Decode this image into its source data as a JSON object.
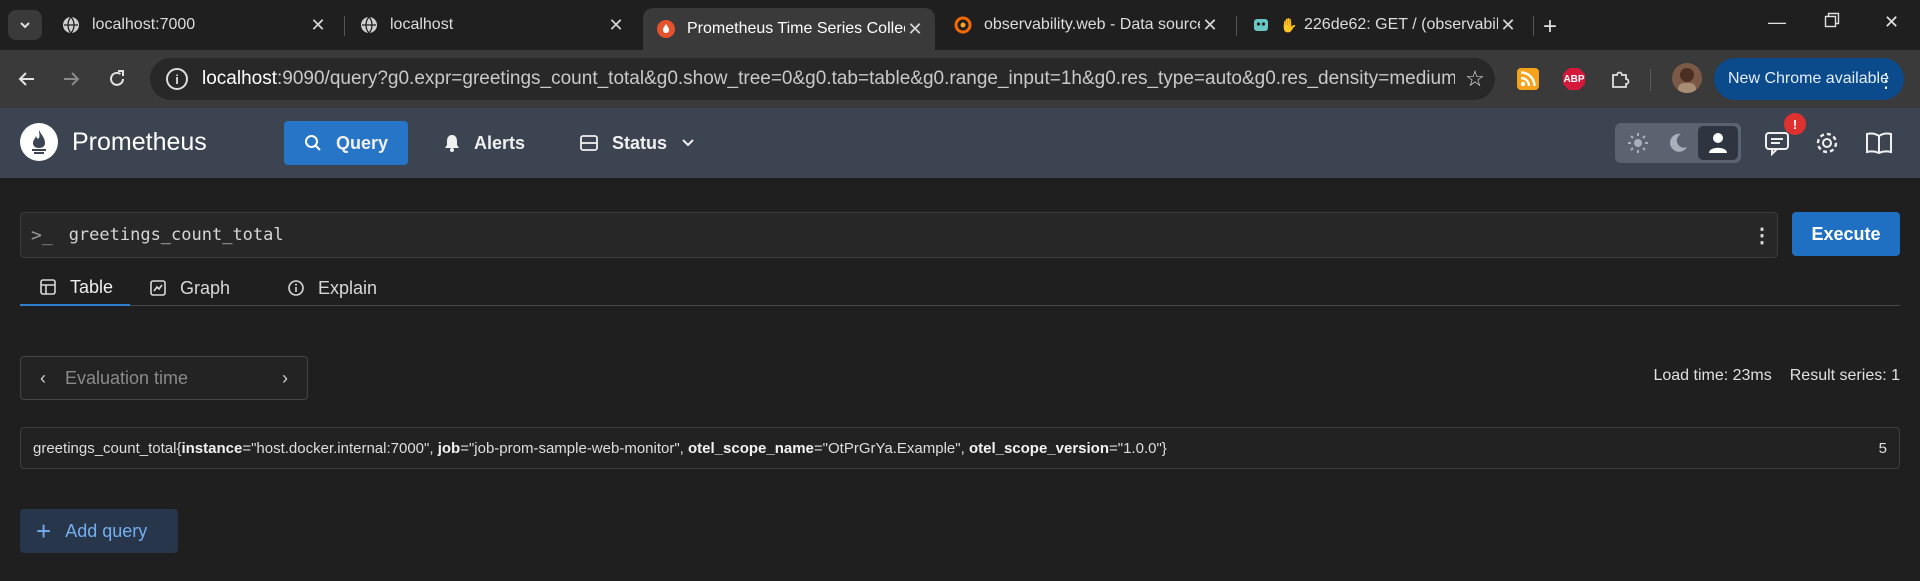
{
  "browser": {
    "tabs": [
      {
        "title": "localhost:7000",
        "favicon": "globe-icon"
      },
      {
        "title": "localhost",
        "favicon": "globe-icon"
      },
      {
        "title": "Prometheus Time Series Collect",
        "favicon": "prometheus-icon",
        "active": true
      },
      {
        "title": "observability.web - Data source",
        "favicon": "grafana-icon"
      },
      {
        "title": "226de62: GET / (observabilit",
        "favicon": "jaeger-icon"
      }
    ],
    "url_host": "localhost",
    "url_rest": ":9090/query?g0.expr=greetings_count_total&g0.show_tree=0&g0.tab=table&g0.range_input=1h&g0.res_type=auto&g0.res_density=medium&g0.dis...",
    "update_label": "New Chrome available",
    "abp_label": "ABP",
    "colors": {
      "tab_bg": "#1f1f1f",
      "toolbar_bg": "#3a3a3a",
      "update_bg": "#0b4a8b"
    }
  },
  "app": {
    "brand": "Prometheus",
    "nav": [
      {
        "label": "Query",
        "icon": "search-icon",
        "active": true
      },
      {
        "label": "Alerts",
        "icon": "bell-icon"
      },
      {
        "label": "Status",
        "icon": "server-icon",
        "dropdown": true
      }
    ],
    "notification_badge": "!",
    "colors": {
      "navbar_bg": "#3c4451",
      "accent": "#2775c6",
      "badge": "#e03131"
    }
  },
  "query": {
    "prompt": ">_",
    "expression": "greetings_count_total",
    "execute_label": "Execute",
    "tabs": [
      {
        "label": "Table",
        "icon": "table-icon",
        "active": true
      },
      {
        "label": "Graph",
        "icon": "graph-icon"
      },
      {
        "label": "Explain",
        "icon": "info-icon"
      }
    ],
    "eval_time_placeholder": "Evaluation time",
    "load_time": "Load time: 23ms",
    "result_series": "Result series: 1",
    "result": {
      "metric": "greetings_count_total",
      "labels": [
        {
          "name": "instance",
          "value": "\"host.docker.internal:7000\""
        },
        {
          "name": "job",
          "value": "\"job-prom-sample-web-monitor\""
        },
        {
          "name": "otel_scope_name",
          "value": "\"OtPrGrYa.Example\""
        },
        {
          "name": "otel_scope_version",
          "value": "\"1.0.0\""
        }
      ],
      "value": "5"
    },
    "add_query_label": "Add query"
  }
}
